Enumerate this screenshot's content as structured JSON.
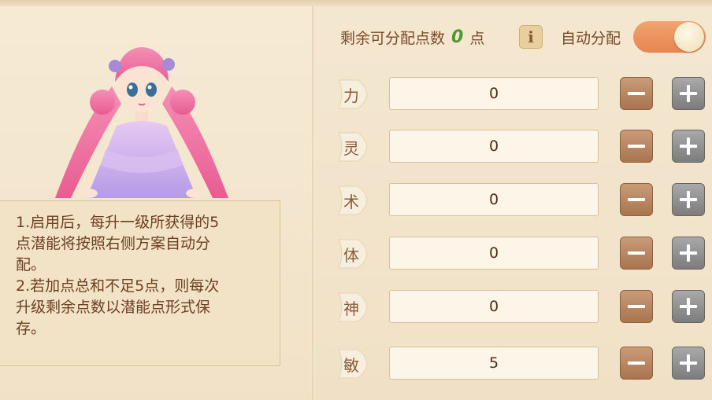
{
  "header": {
    "remaining_label": "剩余可分配点数",
    "remaining_value": "0",
    "remaining_unit": "点",
    "info_icon": "i",
    "auto_assign_label": "自动分配",
    "auto_assign_enabled": true
  },
  "description": {
    "lines": [
      "1.启用后，每升一级所获得的5",
      "点潜能将按照右侧方案自动分",
      "配。",
      "2.若加点总和不足5点，则每次",
      "升级剩余点数以潜能点形式保",
      "存。"
    ]
  },
  "stats": [
    {
      "name": "力",
      "value": "0"
    },
    {
      "name": "灵",
      "value": "0"
    },
    {
      "name": "术",
      "value": "0"
    },
    {
      "name": "体",
      "value": "0"
    },
    {
      "name": "神",
      "value": "0"
    },
    {
      "name": "敏",
      "value": "5"
    }
  ],
  "icons": {
    "minus": "minus-icon",
    "plus": "plus-icon",
    "info": "info-icon"
  },
  "colors": {
    "accent_text": "#7a4a2a",
    "remaining_number": "#4c9a2a",
    "toggle_on": "#e98552",
    "minus_button": "#a8754f",
    "plus_button": "#7c7c7c"
  }
}
